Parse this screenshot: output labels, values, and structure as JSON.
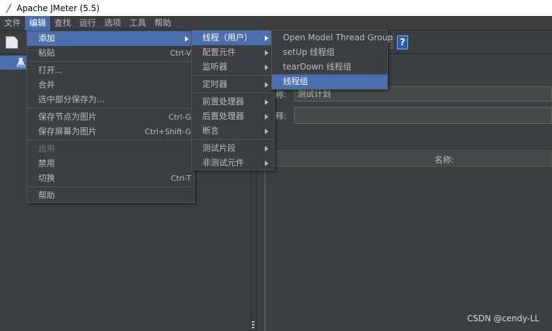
{
  "window": {
    "title": "Apache JMeter (5.5)"
  },
  "menubar": {
    "items": [
      "文件",
      "编辑",
      "查找",
      "运行",
      "选项",
      "工具",
      "帮助"
    ]
  },
  "toolbar": {
    "help_glyph": "?"
  },
  "edit_menu": {
    "items": [
      {
        "label": "添加",
        "accel": "",
        "submenu": true,
        "selected": true
      },
      {
        "label": "粘贴",
        "accel": "Ctrl-V"
      },
      {
        "label": "打开...",
        "accel": ""
      },
      {
        "label": "合并",
        "accel": ""
      },
      {
        "label": "选中部分保存为...",
        "accel": ""
      },
      {
        "label": "保存节点为图片",
        "accel": "Ctrl-G"
      },
      {
        "label": "保存屏幕为图片",
        "accel": "Ctrl+Shift-G"
      },
      {
        "label": "启用",
        "accel": "",
        "disabled": true
      },
      {
        "label": "禁用",
        "accel": ""
      },
      {
        "label": "切换",
        "accel": "Ctrl-T"
      },
      {
        "label": "帮助",
        "accel": ""
      }
    ]
  },
  "add_menu": {
    "items": [
      {
        "label": "线程（用户）",
        "selected": true
      },
      {
        "label": "配置元件"
      },
      {
        "label": "监听器"
      },
      {
        "label": "定时器"
      },
      {
        "label": "前置处理器"
      },
      {
        "label": "后置处理器"
      },
      {
        "label": "断言"
      },
      {
        "label": "测试片段"
      },
      {
        "label": "非测试元件"
      }
    ]
  },
  "threads_menu": {
    "items": [
      {
        "label": "Open Model Thread Group"
      },
      {
        "label": "setUp 线程组"
      },
      {
        "label": "tearDown 线程组"
      },
      {
        "label": "线程组",
        "selected": true
      }
    ]
  },
  "form": {
    "name_label": "称:",
    "name_value": "测试计划",
    "comment_label": "释:"
  },
  "variables_table": {
    "header": "名称:"
  },
  "watermark": "CSDN @cendy-LL",
  "colors": {
    "accent": "#4b6eaf",
    "background": "#3c3f41",
    "text": "#bbbbbb"
  }
}
